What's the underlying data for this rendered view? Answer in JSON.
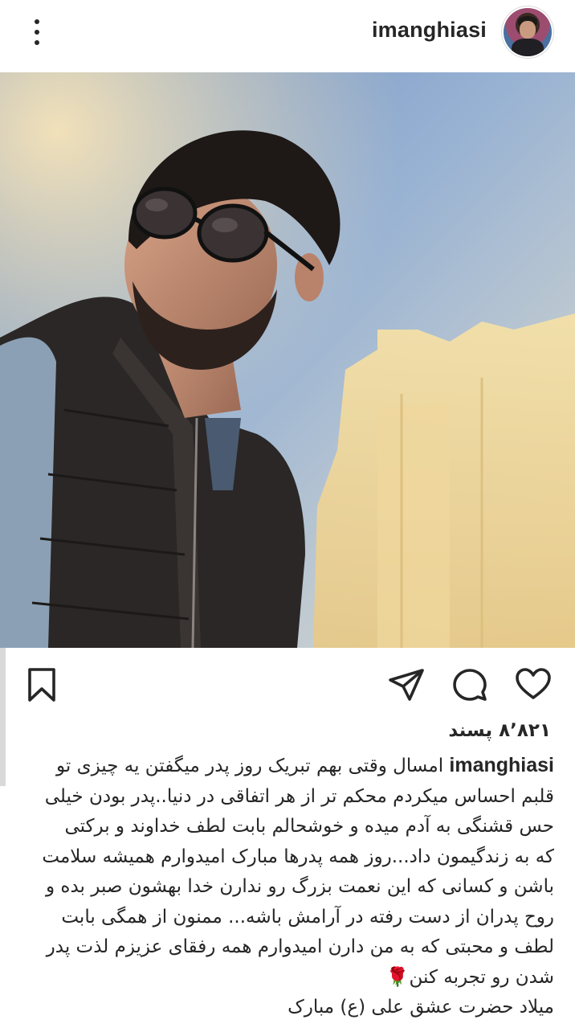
{
  "header": {
    "username": "imanghiasi",
    "more_icon": "more-vertical-icon",
    "avatar_icon": "profile-avatar"
  },
  "post": {
    "image_description_icon": "post-photo",
    "user_tag_icon": "user-tag-icon"
  },
  "actions": {
    "like_icon": "heart-icon",
    "comment_icon": "comment-icon",
    "share_icon": "send-icon",
    "save_icon": "bookmark-icon"
  },
  "likes_text": "۸٬۸۲۱ پسند",
  "caption": {
    "username": "imanghiasi",
    "lines": [
      "امسال وقتی بهم تبریک روز پدر میگفتن یه چیزی تو",
      "قلبم احساس میکردم محکم تر از هر اتفاقی در دنیا..پدر بودن خیلی",
      "حس قشنگی به آدم میده و خوشحالم بابت لطف خداوند و برکتی",
      "که به زندگیمون داد...روز همه پدرها مبارک امیدوارم همیشه سلامت",
      "باشن و کسانی که این نعمت بزرگ رو ندارن خدا بهشون صبر بده و",
      "روح پدران از دست رفته در آرامش باشه... ممنون از همگی بابت",
      "لطف و محبتی که به من دارن امیدوارم همه رفقای عزیزم لذت پدر",
      "شدن رو تجربه کنن",
      "میلاد حضرت عشق علی (ع) مبارک"
    ],
    "rose_emoji": "🌹"
  }
}
